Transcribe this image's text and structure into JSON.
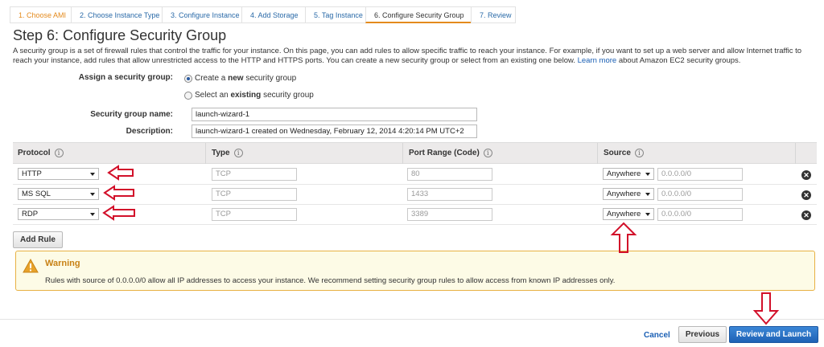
{
  "wizard": {
    "tabs": [
      {
        "label": "1. Choose AMI"
      },
      {
        "label": "2. Choose Instance Type"
      },
      {
        "label": "3. Configure Instance"
      },
      {
        "label": "4. Add Storage"
      },
      {
        "label": "5. Tag Instance"
      },
      {
        "label": "6. Configure Security Group"
      },
      {
        "label": "7. Review"
      }
    ]
  },
  "page": {
    "title": "Step 6: Configure Security Group",
    "description": "A security group is a set of firewall rules that control the traffic for your instance. On this page, you can add rules to allow specific traffic to reach your instance. For example, if you want to set up a web server and allow Internet traffic to reach your instance, add rules that allow unrestricted access to the HTTP and HTTPS ports. You can create a new security group or select from an existing one below.",
    "learn_more": "Learn more",
    "description_tail": "about Amazon EC2 security groups."
  },
  "form": {
    "assign_label": "Assign a security group:",
    "option_create_pre": "Create a",
    "option_create_bold": "new",
    "option_create_post": "security group",
    "option_select_pre": "Select an",
    "option_select_bold": "existing",
    "option_select_post": "security group",
    "name_label": "Security group name:",
    "name_value": "launch-wizard-1",
    "desc_label": "Description:",
    "desc_value": "launch-wizard-1 created on Wednesday, February 12, 2014 4:20:14 PM UTC+2"
  },
  "table": {
    "headers": {
      "protocol": "Protocol",
      "type": "Type",
      "port": "Port Range (Code)",
      "source": "Source",
      "info": "i"
    },
    "rows": [
      {
        "protocol": "HTTP",
        "type": "TCP",
        "port": "80",
        "source": "Anywhere",
        "cidr": "0.0.0.0/0"
      },
      {
        "protocol": "MS SQL",
        "type": "TCP",
        "port": "1433",
        "source": "Anywhere",
        "cidr": "0.0.0.0/0"
      },
      {
        "protocol": "RDP",
        "type": "TCP",
        "port": "3389",
        "source": "Anywhere",
        "cidr": "0.0.0.0/0"
      }
    ],
    "add_rule": "Add Rule"
  },
  "warning": {
    "title": "Warning",
    "text": "Rules with source of 0.0.0.0/0 allow all IP addresses to access your instance. We recommend setting security group rules to allow access from known IP addresses only."
  },
  "footer": {
    "cancel": "Cancel",
    "previous": "Previous",
    "review_launch": "Review and Launch"
  },
  "colors": {
    "accent": "#e48a1c",
    "link": "#1a5fb4",
    "annotation_arrow": "#d2102a",
    "primary_button": "#1e62b5"
  },
  "icons": {
    "warning": "warning-triangle-icon",
    "remove": "remove-rule-icon",
    "info": "info-icon"
  }
}
